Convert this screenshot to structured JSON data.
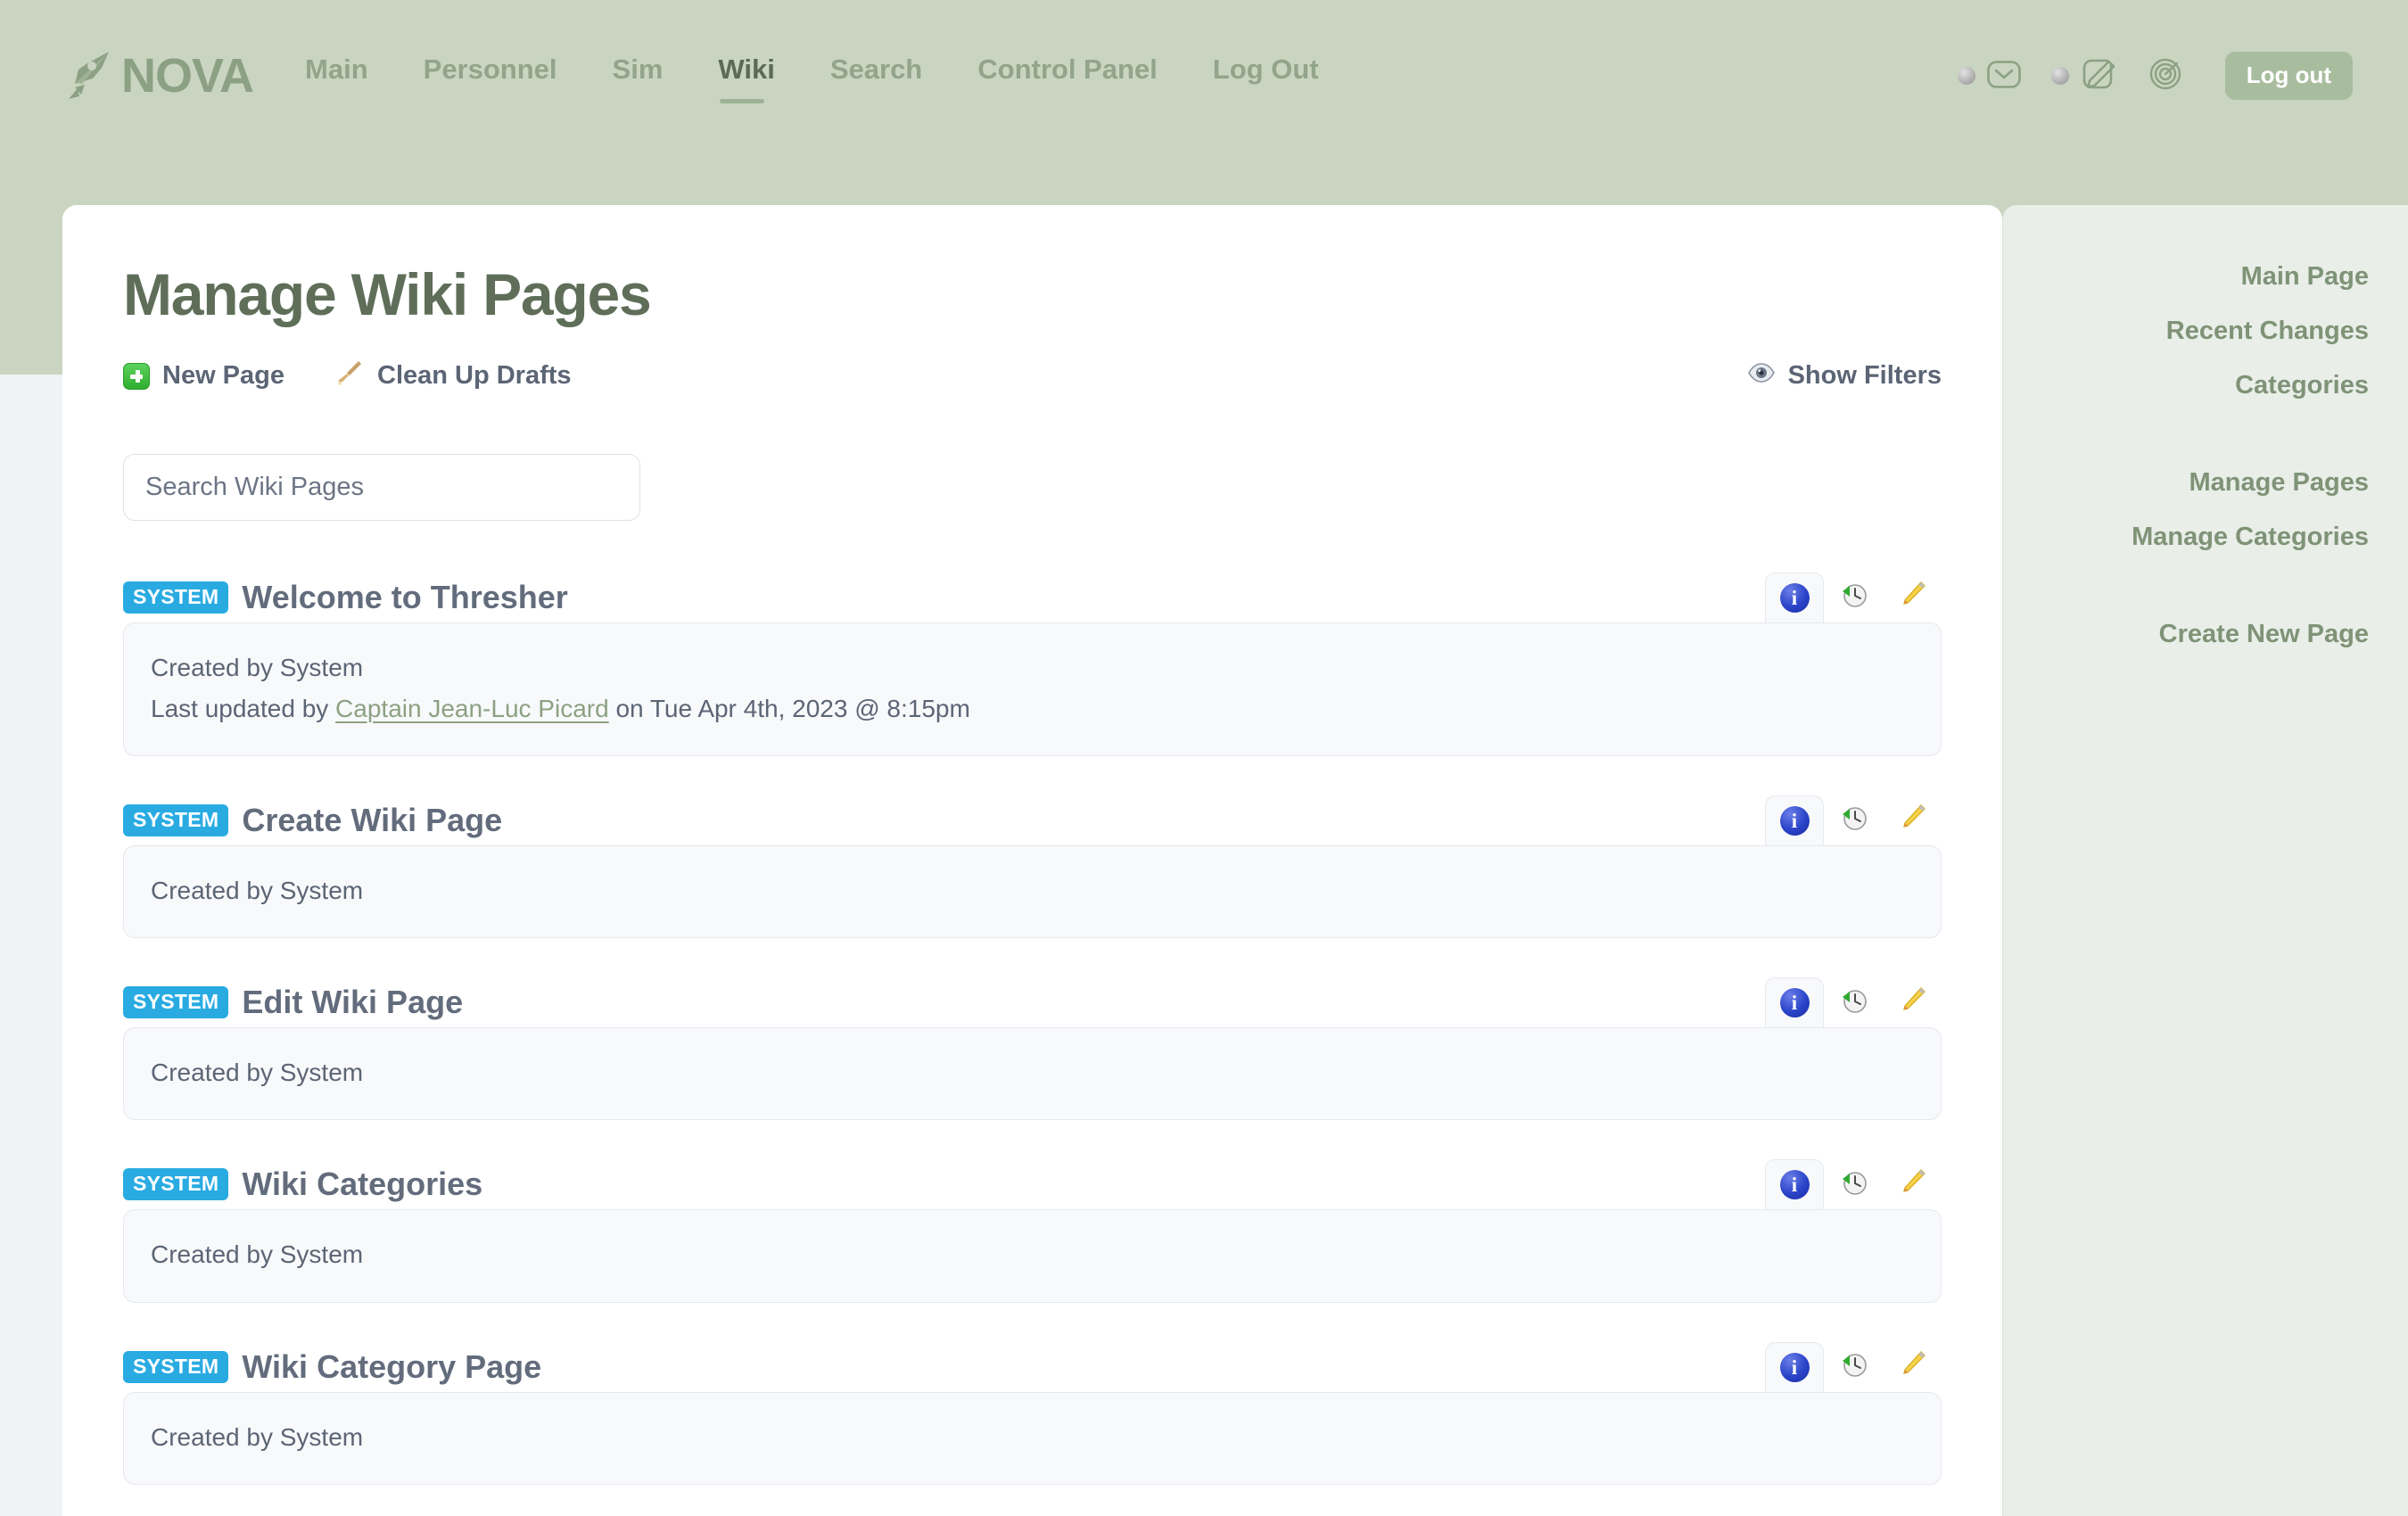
{
  "brand": {
    "name": "NOVA",
    "icon": "pen-nib-icon"
  },
  "nav": {
    "items": [
      {
        "label": "Main",
        "active": false
      },
      {
        "label": "Personnel",
        "active": false
      },
      {
        "label": "Sim",
        "active": false
      },
      {
        "label": "Wiki",
        "active": true
      },
      {
        "label": "Search",
        "active": false
      },
      {
        "label": "Control Panel",
        "active": false
      },
      {
        "label": "Log Out",
        "active": false
      }
    ],
    "icons": [
      {
        "name": "messages-envelope-icon",
        "has_dot": true
      },
      {
        "name": "notepad-pencil-icon",
        "has_dot": true
      },
      {
        "name": "radar-icon",
        "has_dot": false
      }
    ],
    "logout_label": "Log out"
  },
  "page": {
    "title": "Manage Wiki Pages",
    "actions": [
      {
        "label": "New Page",
        "icon": "green-plus-icon"
      },
      {
        "label": "Clean Up Drafts",
        "icon": "broom-icon"
      }
    ],
    "filters": {
      "label": "Show Filters",
      "icon": "eye-icon"
    }
  },
  "search": {
    "value": "",
    "placeholder": "Search Wiki Pages"
  },
  "row_actions": [
    {
      "name": "info-icon",
      "label": "i",
      "active": true
    },
    {
      "name": "history-clock-icon",
      "label": "",
      "active": false
    },
    {
      "name": "edit-pencil-icon",
      "label": "",
      "active": false
    }
  ],
  "wiki_pages": [
    {
      "badge": "SYSTEM",
      "title": "Welcome to Thresher",
      "created_line": "Created by System",
      "updated_prefix": "Last updated by ",
      "updated_user": "Captain Jean-Luc Picard",
      "updated_suffix": " on Tue Apr 4th, 2023 @ 8:15pm"
    },
    {
      "badge": "SYSTEM",
      "title": "Create Wiki Page",
      "created_line": "Created by System",
      "updated_prefix": "",
      "updated_user": "",
      "updated_suffix": ""
    },
    {
      "badge": "SYSTEM",
      "title": "Edit Wiki Page",
      "created_line": "Created by System",
      "updated_prefix": "",
      "updated_user": "",
      "updated_suffix": ""
    },
    {
      "badge": "SYSTEM",
      "title": "Wiki Categories",
      "created_line": "Created by System",
      "updated_prefix": "",
      "updated_user": "",
      "updated_suffix": ""
    },
    {
      "badge": "SYSTEM",
      "title": "Wiki Category Page",
      "created_line": "Created by System",
      "updated_prefix": "",
      "updated_user": "",
      "updated_suffix": ""
    }
  ],
  "sidebar": {
    "group1": [
      "Main Page",
      "Recent Changes",
      "Categories"
    ],
    "group2": [
      "Manage Pages",
      "Manage Categories"
    ],
    "group3": [
      "Create New Page"
    ]
  },
  "colors": {
    "band": "#c9d5c1",
    "brand": "#8ca183",
    "title": "#5f6e59",
    "badge": "#29abe2",
    "sidebar_bg": "#e9eee8",
    "sidebar_link": "#7f9377",
    "link": "#8ca183"
  }
}
